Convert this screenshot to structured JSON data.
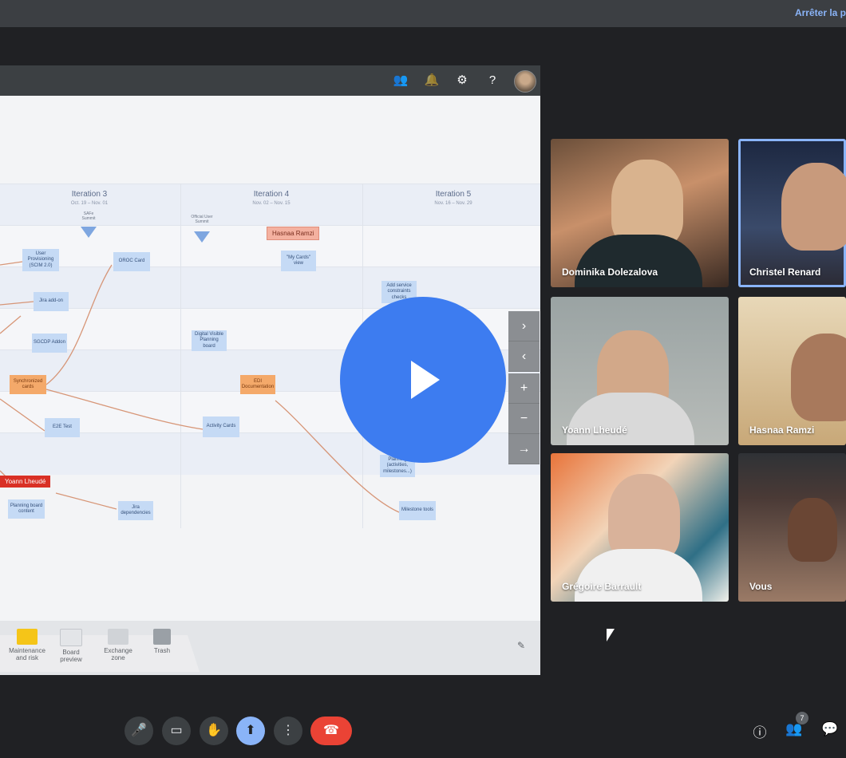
{
  "meeting": {
    "stop_sharing": "Arrêter la p"
  },
  "app_header": {
    "icons": [
      "people-icon",
      "bell-icon",
      "gear-icon",
      "help-icon",
      "avatar"
    ]
  },
  "board": {
    "iterations": [
      {
        "title": "Iteration 3",
        "dates": "Oct. 19 – Nov. 01"
      },
      {
        "title": "Iteration 4",
        "dates": "Nov. 02 – Nov. 15"
      },
      {
        "title": "Iteration 5",
        "dates": "Nov. 16 – Nov. 29"
      }
    ],
    "milestones": [
      {
        "label": "SAFe Summit"
      },
      {
        "label": "Official User Summit"
      }
    ],
    "cards": [
      {
        "text": "User Provisioning (SCIM 2.0)",
        "color": "blue"
      },
      {
        "text": "OROC Card",
        "color": "blue"
      },
      {
        "text": "\"My Cards\" view",
        "color": "blue"
      },
      {
        "text": "Add service constraints checks",
        "color": "blue"
      },
      {
        "text": "Jira add-on",
        "color": "blue"
      },
      {
        "text": "SGCDP Addon",
        "color": "blue"
      },
      {
        "text": "Digital Visible Planning board",
        "color": "blue"
      },
      {
        "text": "Synchronized cards",
        "color": "orange"
      },
      {
        "text": "EDI Documentation",
        "color": "orange"
      },
      {
        "text": "E2E Test",
        "color": "blue"
      },
      {
        "text": "Activity Cards",
        "color": "blue"
      },
      {
        "text": "Planning (activities, milestones...)",
        "color": "blue"
      },
      {
        "text": "Planning board content",
        "color": "blue"
      },
      {
        "text": "Jira dependencies",
        "color": "blue"
      },
      {
        "text": "Milestone tools",
        "color": "blue"
      }
    ],
    "user_tags": [
      {
        "name": "Hasnaa Ramzi"
      },
      {
        "name": "Yoann Lheudé"
      }
    ],
    "tray_items": [
      {
        "label": "Maintenance and risk",
        "color": "#f5c518"
      },
      {
        "label": "Board preview",
        "color": "#e3e5e8"
      },
      {
        "label": "Exchange zone",
        "color": "#d0d3d7"
      },
      {
        "label": "Trash",
        "color": "#9aa0a6"
      }
    ],
    "side_controls": [
      "›",
      "‹",
      "+",
      "−",
      "→"
    ]
  },
  "participants": [
    {
      "name": "Dominika Dolezalova",
      "active": false
    },
    {
      "name": "Christel Renard",
      "active": true
    },
    {
      "name": "Yoann Lheudé",
      "active": false
    },
    {
      "name": "Hasnaa Ramzi",
      "active": false
    },
    {
      "name": "Grégoire Barrault",
      "active": false
    },
    {
      "name": "Vous",
      "active": false
    }
  ],
  "controls": {
    "buttons": [
      "mic-icon",
      "camera-icon",
      "raise-hand-icon",
      "present-icon",
      "more-icon",
      "end-call-icon"
    ],
    "participant_count": "7"
  }
}
